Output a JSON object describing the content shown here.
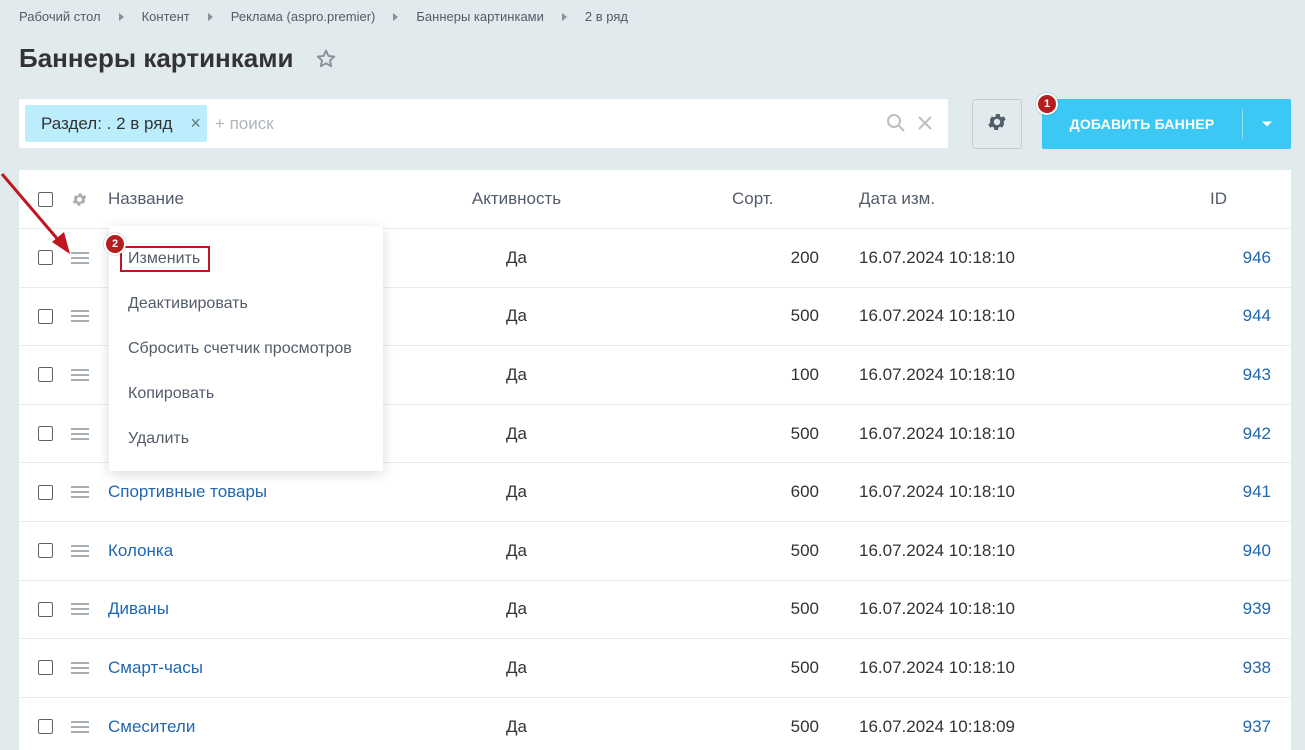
{
  "breadcrumb": [
    "Рабочий стол",
    "Контент",
    "Реклама (aspro.premier)",
    "Баннеры картинками",
    "2 в ряд"
  ],
  "page": {
    "title": "Баннеры картинками"
  },
  "filter": {
    "tag_label": "Раздел: . 2 в ряд",
    "search_placeholder": "+ поиск"
  },
  "toolbar": {
    "add_label": "ДОБАВИТЬ БАННЕР",
    "badge1": "1"
  },
  "table": {
    "headers": {
      "name": "Название",
      "active": "Активность",
      "sort": "Сорт.",
      "date": "Дата изм.",
      "id": "ID"
    },
    "rows": [
      {
        "name": "",
        "active": "Да",
        "sort": "200",
        "date": "16.07.2024 10:18:10",
        "id": "946"
      },
      {
        "name": "",
        "active": "Да",
        "sort": "500",
        "date": "16.07.2024 10:18:10",
        "id": "944"
      },
      {
        "name": "",
        "active": "Да",
        "sort": "100",
        "date": "16.07.2024 10:18:10",
        "id": "943"
      },
      {
        "name": "",
        "active": "Да",
        "sort": "500",
        "date": "16.07.2024 10:18:10",
        "id": "942"
      },
      {
        "name": "Спортивные товары",
        "active": "Да",
        "sort": "600",
        "date": "16.07.2024 10:18:10",
        "id": "941"
      },
      {
        "name": "Колонка",
        "active": "Да",
        "sort": "500",
        "date": "16.07.2024 10:18:10",
        "id": "940"
      },
      {
        "name": "Диваны",
        "active": "Да",
        "sort": "500",
        "date": "16.07.2024 10:18:10",
        "id": "939"
      },
      {
        "name": "Смарт-часы",
        "active": "Да",
        "sort": "500",
        "date": "16.07.2024 10:18:10",
        "id": "938"
      },
      {
        "name": "Смесители",
        "active": "Да",
        "sort": "500",
        "date": "16.07.2024 10:18:09",
        "id": "937"
      }
    ]
  },
  "context_menu": {
    "items": [
      "Изменить",
      "Деактивировать",
      "Сбросить счетчик просмотров",
      "Копировать",
      "Удалить"
    ],
    "badge2": "2"
  },
  "colors": {
    "accent": "#3bc8f5",
    "link": "#2067b0",
    "annotation": "#c0161f"
  }
}
